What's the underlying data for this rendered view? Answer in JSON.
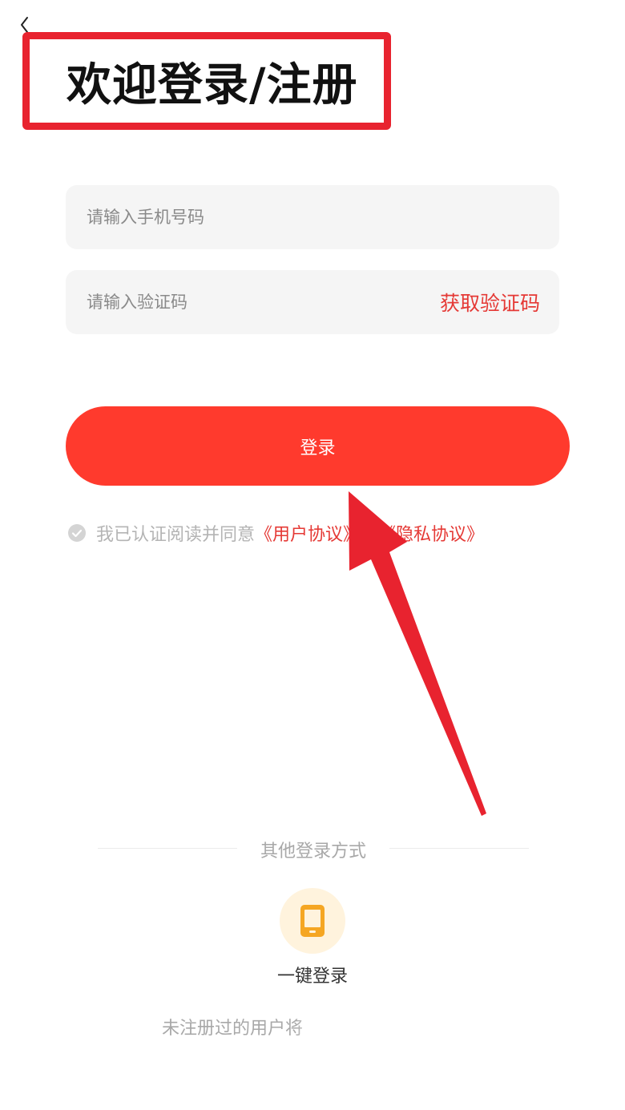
{
  "header": {
    "back_icon": "chevron-left-icon",
    "title": "欢迎登录/注册"
  },
  "form": {
    "phone_placeholder": "请输入手机号码",
    "code_placeholder": "请输入验证码",
    "get_code_label": "获取验证码",
    "login_label": "登录"
  },
  "agreement": {
    "checkbox_icon": "check-circle-icon",
    "checked": true,
    "prefix": "我已认证阅读并同意",
    "user_agreement": "《用户协议》",
    "connector": "和",
    "privacy_policy": "《隐私协议》"
  },
  "other_login": {
    "divider_label": "其他登录方式",
    "one_key_icon": "phone-icon",
    "one_key_label": "一键登录"
  },
  "footer": {
    "note": "未注册过的用户将"
  },
  "colors": {
    "accent": "#ff3a2d",
    "link": "#e53935",
    "annotation": "#e8232f",
    "phone_icon": "#f5a623",
    "phone_icon_bg": "#fff3dd"
  }
}
